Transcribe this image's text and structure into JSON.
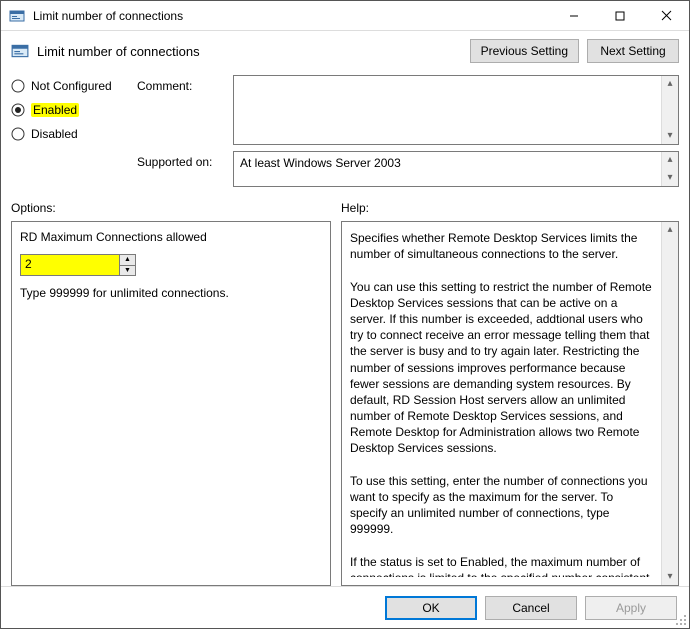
{
  "window": {
    "title": "Limit number of connections"
  },
  "header": {
    "label": "Limit number of connections",
    "prev": "Previous Setting",
    "next": "Next Setting"
  },
  "radios": {
    "not_configured": "Not Configured",
    "enabled": "Enabled",
    "disabled": "Disabled",
    "selected": "enabled"
  },
  "labels": {
    "comment": "Comment:",
    "supported": "Supported on:",
    "options": "Options:",
    "help": "Help:"
  },
  "supported_on": "At least Windows Server 2003",
  "options": {
    "field_label": "RD Maximum Connections allowed",
    "value": "2",
    "hint": "Type 999999 for unlimited connections."
  },
  "help_text": "Specifies whether Remote Desktop Services limits the number of simultaneous connections to the server.\n\nYou can use this setting to restrict the number of Remote Desktop Services sessions that can be active on a server. If this number is exceeded, addtional users who try to connect receive an error message telling them that the server is busy and to try again later. Restricting the number of sessions improves performance because fewer sessions are demanding system resources. By default, RD Session Host servers allow an unlimited number of Remote Desktop Services sessions, and Remote Desktop for Administration allows two Remote Desktop Services sessions.\n\nTo use this setting, enter the number of connections you want to specify as the maximum for the server. To specify an unlimited number of connections, type 999999.\n\nIf the status is set to Enabled, the maximum number of connections is limited to the specified number consistent with the version of Windows and the mode of Remote Desktop",
  "footer": {
    "ok": "OK",
    "cancel": "Cancel",
    "apply": "Apply"
  }
}
